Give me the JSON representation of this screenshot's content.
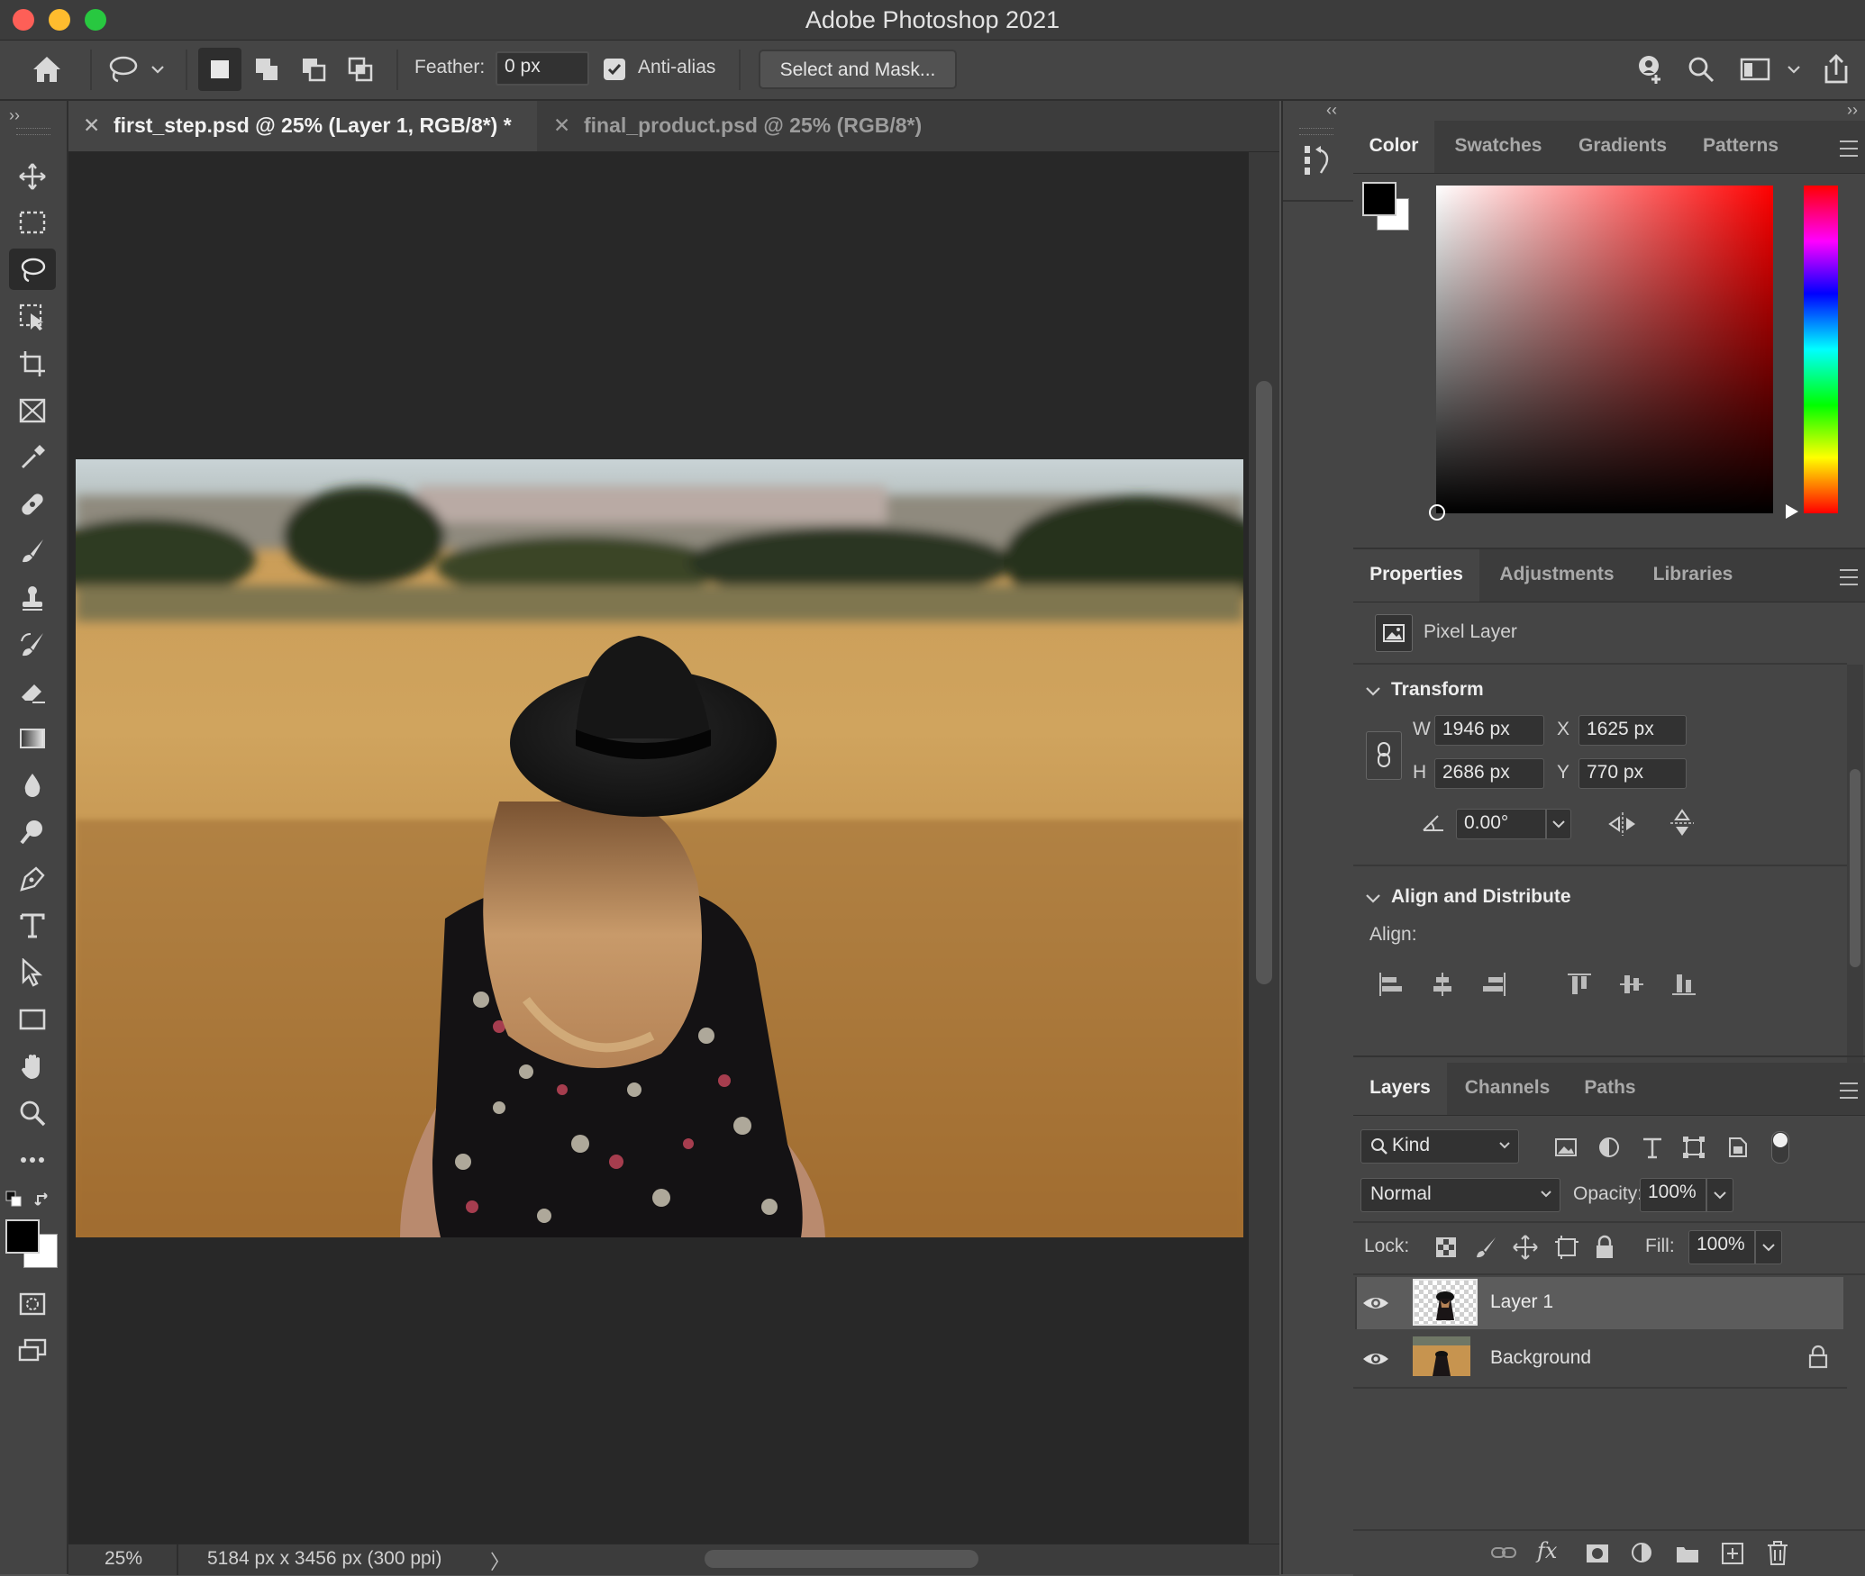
{
  "app": {
    "title": "Adobe Photoshop 2021"
  },
  "options_bar": {
    "feather_label": "Feather:",
    "feather_value": "0 px",
    "anti_alias_label": "Anti-alias",
    "anti_alias_checked": true,
    "select_mask_label": "Select and Mask..."
  },
  "document_tabs": [
    {
      "label": "first_step.psd @ 25% (Layer 1, RGB/8*) *",
      "active": true
    },
    {
      "label": "final_product.psd @ 25% (RGB/8*)",
      "active": false
    }
  ],
  "status": {
    "zoom": "25%",
    "doc_info": "5184 px x 3456 px (300 ppi)"
  },
  "color_panel": {
    "tabs": [
      "Color",
      "Swatches",
      "Gradients",
      "Patterns"
    ],
    "active_tab": "Color",
    "foreground": "#000000",
    "background": "#ffffff",
    "hue": "#ff0000"
  },
  "properties_panel": {
    "tabs": [
      "Properties",
      "Adjustments",
      "Libraries"
    ],
    "active_tab": "Properties",
    "layer_type": "Pixel Layer",
    "transform": {
      "title": "Transform",
      "w_label": "W",
      "w": "1946 px",
      "h_label": "H",
      "h": "2686 px",
      "x_label": "X",
      "x": "1625 px",
      "y_label": "Y",
      "y": "770 px",
      "angle": "0.00°"
    },
    "align": {
      "title": "Align and Distribute",
      "label": "Align:"
    }
  },
  "layers_panel": {
    "tabs": [
      "Layers",
      "Channels",
      "Paths"
    ],
    "active_tab": "Layers",
    "filter_kind": "Kind",
    "blend_mode": "Normal",
    "opacity_label": "Opacity:",
    "opacity": "100%",
    "lock_label": "Lock:",
    "fill_label": "Fill:",
    "fill": "100%",
    "layers": [
      {
        "name": "Layer 1",
        "selected": true,
        "visible": true,
        "locked": false
      },
      {
        "name": "Background",
        "selected": false,
        "visible": true,
        "locked": true
      }
    ]
  }
}
